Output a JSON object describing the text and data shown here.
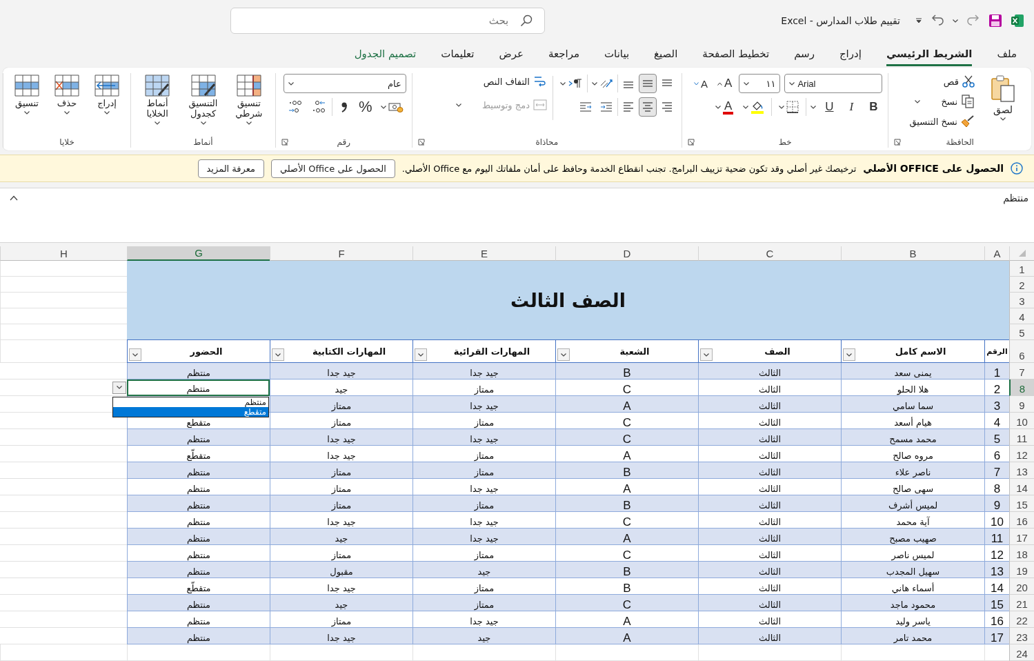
{
  "window": {
    "title": "تقييم طلاب المدارس  -  Excel"
  },
  "search": {
    "placeholder": "بحث"
  },
  "tabs": [
    {
      "label": "ملف",
      "selected": false,
      "contextual": false
    },
    {
      "label": "الشريط الرئيسي",
      "selected": true,
      "contextual": false
    },
    {
      "label": "إدراج",
      "selected": false,
      "contextual": false
    },
    {
      "label": "رسم",
      "selected": false,
      "contextual": false
    },
    {
      "label": "تخطيط الصفحة",
      "selected": false,
      "contextual": false
    },
    {
      "label": "الصيغ",
      "selected": false,
      "contextual": false
    },
    {
      "label": "بيانات",
      "selected": false,
      "contextual": false
    },
    {
      "label": "مراجعة",
      "selected": false,
      "contextual": false
    },
    {
      "label": "عرض",
      "selected": false,
      "contextual": false
    },
    {
      "label": "تعليمات",
      "selected": false,
      "contextual": false
    },
    {
      "label": "تصميم الجدول",
      "selected": false,
      "contextual": true
    }
  ],
  "ribbon": {
    "groups": [
      {
        "kind": "clipboard",
        "label": "الحافظة",
        "launcher": true,
        "paste": "لصق",
        "cut": "قص",
        "copy": "نسخ",
        "format_painter": "نسخ التنسيق"
      },
      {
        "kind": "font",
        "label": "خط",
        "launcher": true,
        "font_name": "Arial",
        "font_size": "١١",
        "grow": "A",
        "shrink": "A",
        "bold": "B",
        "italic": "I",
        "underline": "U",
        "font_color": "A"
      },
      {
        "kind": "alignment",
        "label": "محاذاة",
        "launcher": true,
        "vertical": [
          {
            "selected": false
          },
          {
            "selected": true
          },
          {
            "selected": false
          }
        ],
        "horizontal": [
          {
            "selected": false
          },
          {
            "selected": true
          },
          {
            "selected": false
          }
        ],
        "wrap_text": "التفاف النص",
        "merge": {
          "label": "دمج وتوسيط",
          "disabled": true
        }
      },
      {
        "kind": "number",
        "label": "رقم",
        "launcher": true,
        "format": "عام",
        "percent": "%"
      },
      {
        "kind": "styles",
        "label": "أنماط",
        "launcher": false,
        "buttons": [
          "تنسيق شرطي",
          "التنسيق كجدول",
          "أنماط الخلايا"
        ]
      },
      {
        "kind": "cells",
        "label": "خلايا",
        "launcher": false,
        "buttons": [
          "إدراج",
          "حذف",
          "تنسيق"
        ]
      }
    ]
  },
  "notice": {
    "title": "الحصول على OFFICE الأصلي",
    "message": "ترخيصك غير أصلي وقد تكون ضحية تزييف البرامج. تجنب انقطاع الخدمة وحافظ على أمان ملفاتك اليوم مع Office الأصلي.",
    "buttons": [
      "الحصول على Office الأصلي",
      "معرفة المزيد"
    ]
  },
  "formula_bar": {
    "value": "منتظم"
  },
  "sheet": {
    "columns": [
      {
        "label": "A",
        "selected": false
      },
      {
        "label": "B",
        "selected": false
      },
      {
        "label": "C",
        "selected": false
      },
      {
        "label": "D",
        "selected": false
      },
      {
        "label": "E",
        "selected": false
      },
      {
        "label": "F",
        "selected": false
      },
      {
        "label": "G",
        "selected": true
      },
      {
        "label": "H",
        "selected": false
      }
    ],
    "row_numbers": [
      {
        "label": "1",
        "selected": false
      },
      {
        "label": "2",
        "selected": false
      },
      {
        "label": "3",
        "selected": false
      },
      {
        "label": "4",
        "selected": false
      },
      {
        "label": "5",
        "selected": false
      },
      {
        "label": "6",
        "selected": false
      },
      {
        "label": "7",
        "selected": false
      },
      {
        "label": "8",
        "selected": true
      },
      {
        "label": "9",
        "selected": false
      },
      {
        "label": "10",
        "selected": false
      },
      {
        "label": "11",
        "selected": false
      },
      {
        "label": "12",
        "selected": false
      },
      {
        "label": "13",
        "selected": false
      },
      {
        "label": "14",
        "selected": false
      },
      {
        "label": "15",
        "selected": false
      },
      {
        "label": "16",
        "selected": false
      },
      {
        "label": "17",
        "selected": false
      },
      {
        "label": "18",
        "selected": false
      },
      {
        "label": "19",
        "selected": false
      },
      {
        "label": "20",
        "selected": false
      },
      {
        "label": "21",
        "selected": false
      },
      {
        "label": "22",
        "selected": false
      },
      {
        "label": "23",
        "selected": false
      },
      {
        "label": "24",
        "selected": false
      }
    ],
    "title": "الصف الثالث",
    "headers": [
      {
        "label": "الرقم",
        "filter": false
      },
      {
        "label": "الاسم كامل",
        "filter": true
      },
      {
        "label": "الصف",
        "filter": true
      },
      {
        "label": "الشعبة",
        "filter": true
      },
      {
        "label": "المهارات القرائية",
        "filter": true
      },
      {
        "label": "المهارات الكتابية",
        "filter": true
      },
      {
        "label": "الحضور",
        "filter": true
      }
    ],
    "rows": [
      {
        "active": false,
        "cells": [
          "1",
          "يمنى سعد",
          "الثالث",
          "B",
          "جيد جدا",
          "جيد جدا",
          "منتظم"
        ]
      },
      {
        "active": true,
        "cells": [
          "2",
          "هلا الحلو",
          "الثالث",
          "C",
          "ممتاز",
          "جيد",
          "منتظم"
        ]
      },
      {
        "active": false,
        "cells": [
          "3",
          "سما سامي",
          "الثالث",
          "A",
          "جيد جدا",
          "ممتاز"
        ]
      },
      {
        "active": false,
        "cells": [
          "4",
          "هيام أسعد",
          "الثالث",
          "C",
          "ممتاز",
          "ممتاز",
          "متقطع"
        ]
      },
      {
        "active": false,
        "cells": [
          "5",
          "محمد مسمح",
          "الثالث",
          "C",
          "جيد جدا",
          "جيد جدا",
          "منتظم"
        ]
      },
      {
        "active": false,
        "cells": [
          "6",
          "مروه صالح",
          "الثالث",
          "A",
          "ممتاز",
          "جيد جدا",
          "متقطّع"
        ]
      },
      {
        "active": false,
        "cells": [
          "7",
          "ناصر علاء",
          "الثالث",
          "B",
          "ممتاز",
          "ممتاز",
          "منتظم"
        ]
      },
      {
        "active": false,
        "cells": [
          "8",
          "سهى صالح",
          "الثالث",
          "A",
          "جيد جدا",
          "ممتاز",
          "منتظم"
        ]
      },
      {
        "active": false,
        "cells": [
          "9",
          "لميس أشرف",
          "الثالث",
          "B",
          "ممتاز",
          "ممتاز",
          "منتظم"
        ]
      },
      {
        "active": false,
        "cells": [
          "10",
          "آية محمد",
          "الثالث",
          "C",
          "جيد جدا",
          "جيد جدا",
          "منتظم"
        ]
      },
      {
        "active": false,
        "cells": [
          "11",
          "صهيب مصبح",
          "الثالث",
          "A",
          "جيد جدا",
          "جيد",
          "منتظم"
        ]
      },
      {
        "active": false,
        "cells": [
          "12",
          "لميس ناصر",
          "الثالث",
          "C",
          "ممتاز",
          "ممتاز",
          "منتظم"
        ]
      },
      {
        "active": false,
        "cells": [
          "13",
          "سهيل المجدب",
          "الثالث",
          "B",
          "جيد",
          "مقبول",
          "منتظم"
        ]
      },
      {
        "active": false,
        "cells": [
          "14",
          "أسماء هاني",
          "الثالث",
          "B",
          "ممتاز",
          "جيد جدا",
          "متقطّع"
        ]
      },
      {
        "active": false,
        "cells": [
          "15",
          "محمود ماجد",
          "الثالث",
          "C",
          "ممتاز",
          "جيد",
          "منتظم"
        ]
      },
      {
        "active": false,
        "cells": [
          "16",
          "ياسر وليد",
          "الثالث",
          "A",
          "جيد جدا",
          "ممتاز",
          "منتظم"
        ]
      },
      {
        "active": false,
        "cells": [
          "17",
          "محمد تامر",
          "الثالث",
          "A",
          "جيد",
          "جيد جدا",
          "منتظم"
        ]
      }
    ],
    "validation_list": {
      "items": [
        {
          "label": "منتظم",
          "selected": false
        },
        {
          "label": "متقطع",
          "selected": true
        }
      ]
    }
  }
}
